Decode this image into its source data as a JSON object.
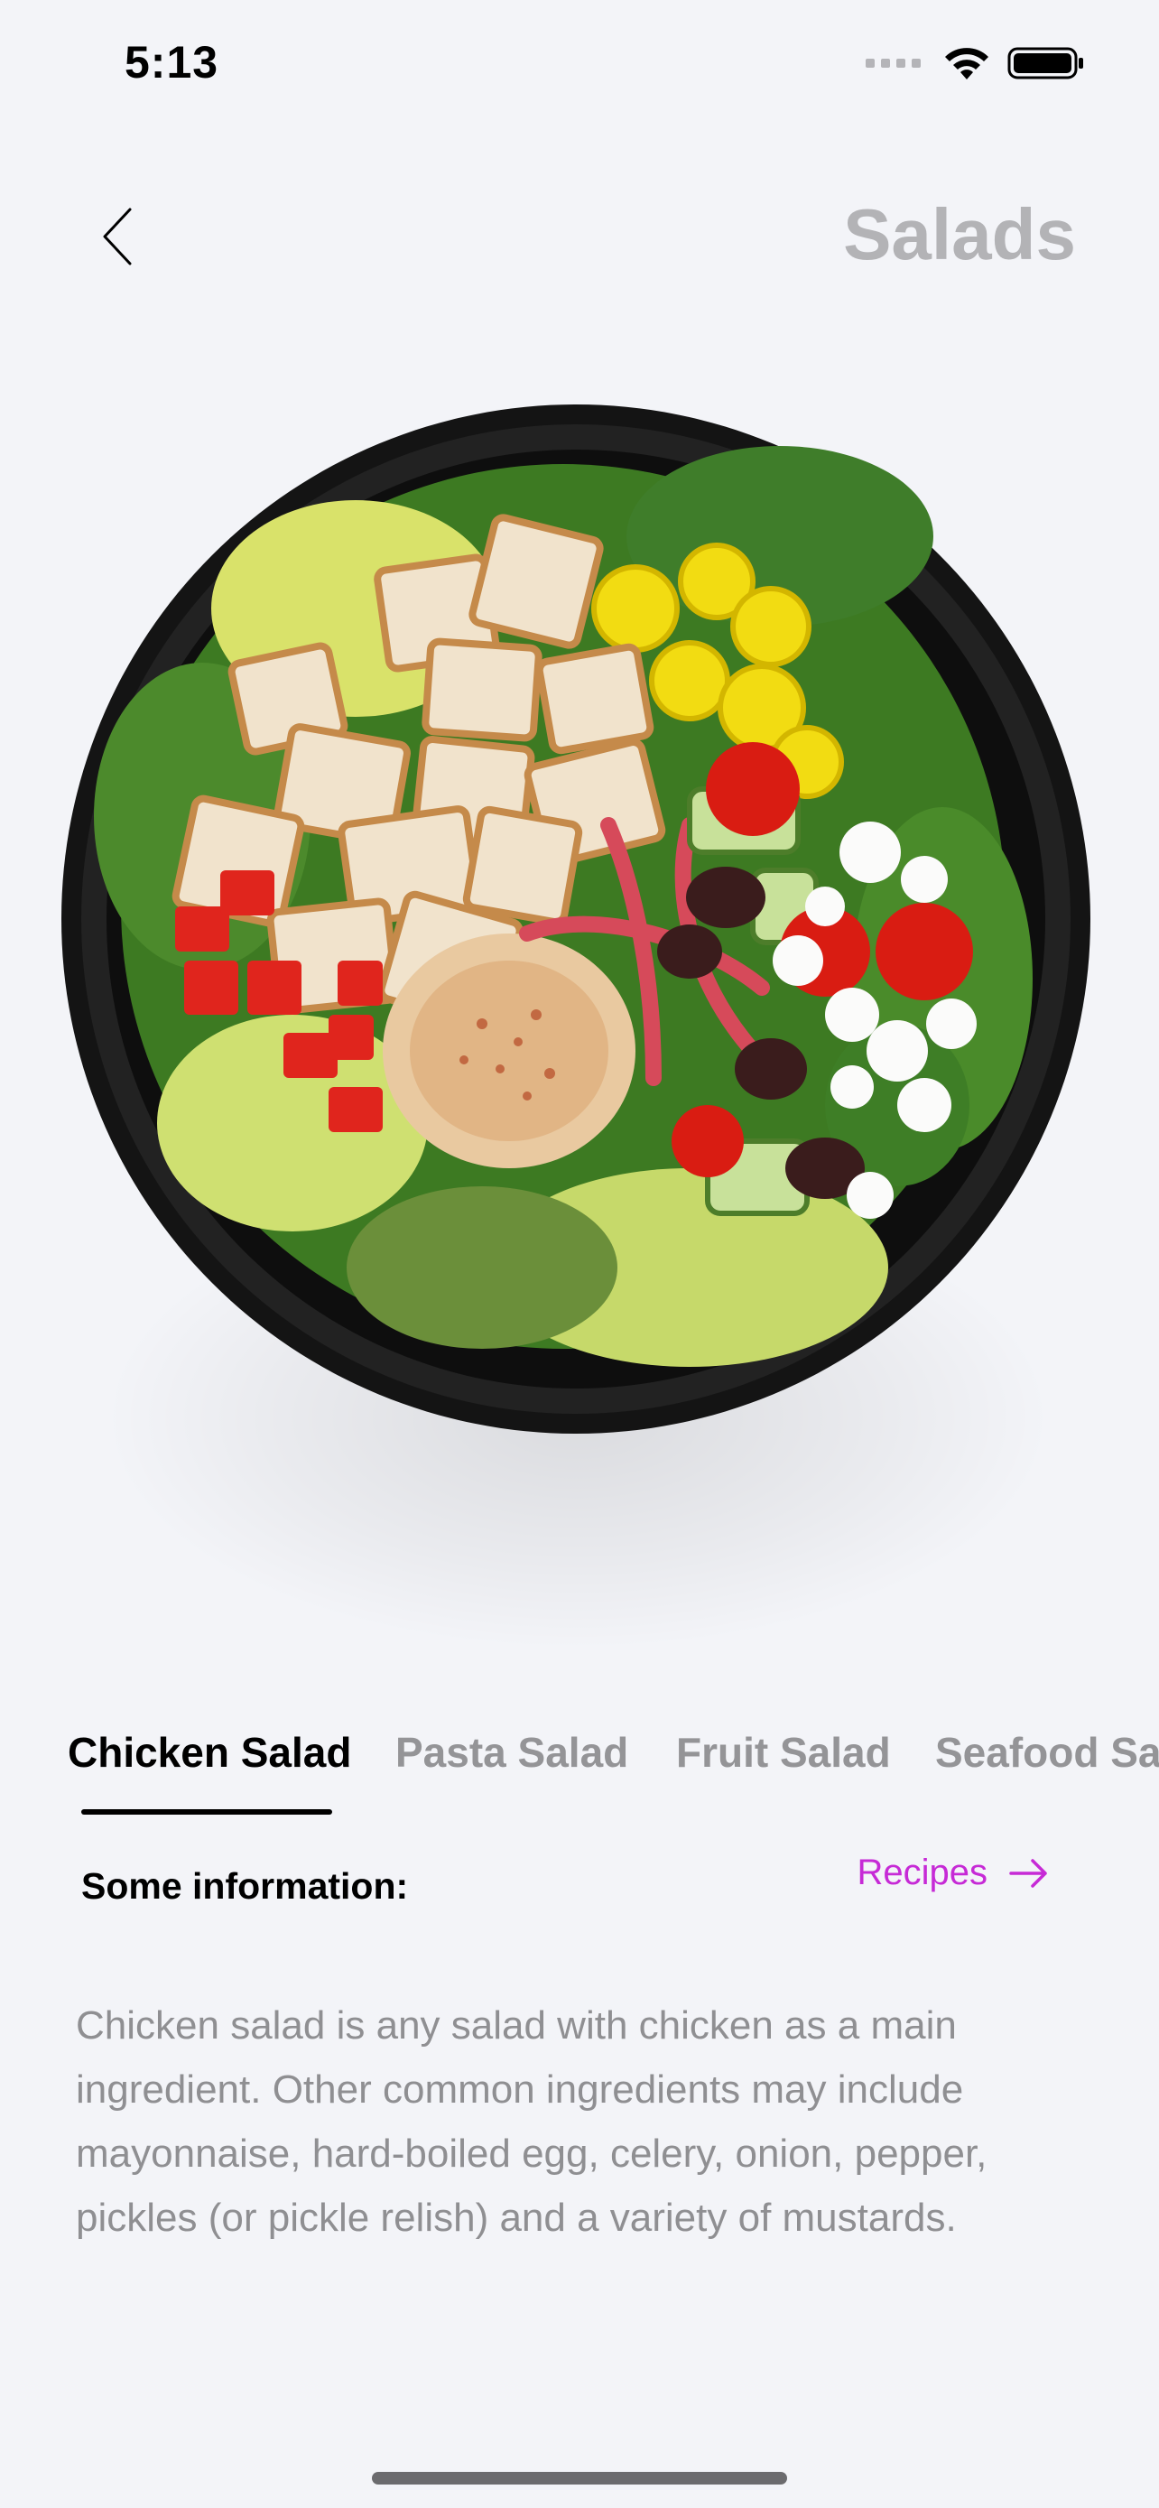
{
  "status_bar": {
    "time": "5:13",
    "icons": [
      "signal-dots-icon",
      "wifi-icon",
      "battery-icon"
    ]
  },
  "header": {
    "back_icon": "chevron-left-icon",
    "title": "Salads"
  },
  "hero": {
    "image_subject": "chicken-salad-bowl"
  },
  "tabs": {
    "items": [
      {
        "label": "Chicken Salad",
        "active": true
      },
      {
        "label": "Pasta Salad",
        "active": false
      },
      {
        "label": "Fruit Salad",
        "active": false
      },
      {
        "label": "Seafood Salad",
        "active": false
      }
    ]
  },
  "info": {
    "heading": "Some information:",
    "link_label": "Recipes",
    "link_icon": "arrow-right-icon",
    "description": "Chicken salad is any salad with chicken as a main ingredient. Other common ingredients may include mayonnaise, hard-boiled egg, celery, onion, pepper, pickles (or pickle relish) and a variety of mustards."
  },
  "colors": {
    "background": "#f3f4f8",
    "title": "#b3b3b6",
    "tab_inactive": "#949497",
    "accent": "#c62ad6",
    "description": "#8f8f92"
  }
}
